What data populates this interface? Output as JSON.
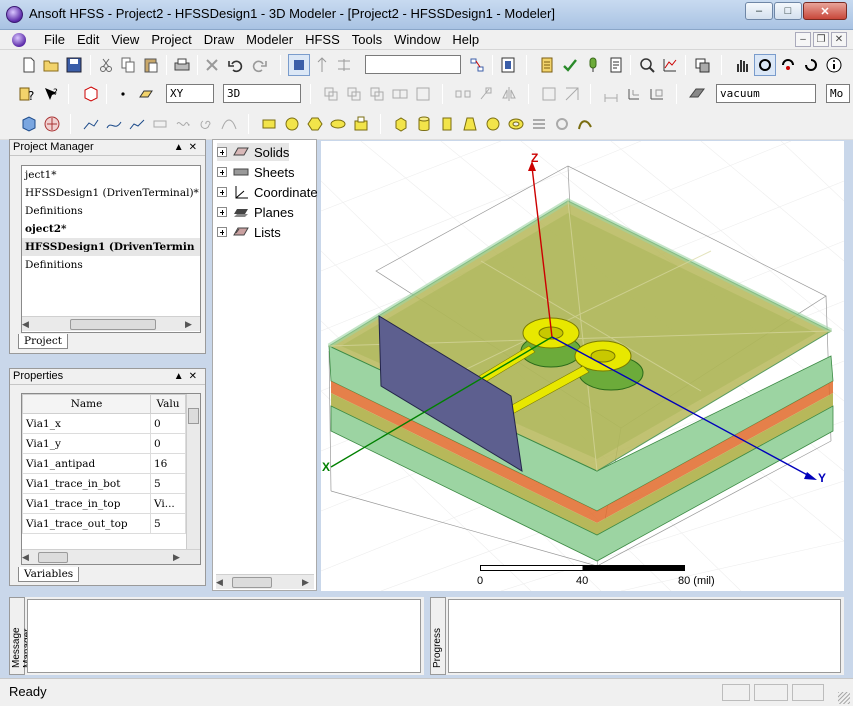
{
  "window": {
    "title": "Ansoft HFSS  - Project2 - HFSSDesign1 - 3D Modeler - [Project2 - HFSSDesign1 - Modeler]",
    "minimize": "–",
    "maximize": "□",
    "close": "✕"
  },
  "menu": [
    "File",
    "Edit",
    "View",
    "Project",
    "Draw",
    "Modeler",
    "HFSS",
    "Tools",
    "Window",
    "Help"
  ],
  "toolbar": {
    "plane_combo": "XY",
    "view_combo": "3D",
    "material_combo": "vacuum",
    "model_combo": "Mo",
    "empty_combo": ""
  },
  "project_manager": {
    "title": "Project Manager",
    "lines": [
      {
        "text": "ject1*",
        "style": ""
      },
      {
        "text": "HFSSDesign1 (DrivenTerminal)*",
        "style": ""
      },
      {
        "text": "Definitions",
        "style": ""
      },
      {
        "text": "oject2*",
        "style": "bold"
      },
      {
        "text": "HFSSDesign1 (DrivenTermin",
        "style": "bold sel"
      },
      {
        "text": "Definitions",
        "style": ""
      }
    ],
    "tab": "Project"
  },
  "properties": {
    "title": "Properties",
    "columns": [
      "Name",
      "Valu"
    ],
    "rows": [
      {
        "name": "Via1_x",
        "value": "0"
      },
      {
        "name": "Via1_y",
        "value": "0"
      },
      {
        "name": "Via1_antipad",
        "value": "16"
      },
      {
        "name": "Via1_trace_in_bot",
        "value": "5"
      },
      {
        "name": "Via1_trace_in_top",
        "value": "Vi..."
      },
      {
        "name": "Via1_trace_out_top",
        "value": "5"
      }
    ],
    "tab": "Variables"
  },
  "model_tree": [
    {
      "label": "Solids",
      "icon": "solids-icon"
    },
    {
      "label": "Sheets",
      "icon": "sheets-icon"
    },
    {
      "label": "Coordinate",
      "icon": "coordinate-icon"
    },
    {
      "label": "Planes",
      "icon": "planes-icon"
    },
    {
      "label": "Lists",
      "icon": "lists-icon"
    }
  ],
  "viewport": {
    "axis_z": "Z",
    "axis_x": "X",
    "axis_y": "Y",
    "scale_labels": [
      "0",
      "40",
      "80 (mil)"
    ]
  },
  "bottom": {
    "message_tab": "Message Manager",
    "progress_tab": "Progress"
  },
  "status": "Ready",
  "colors": {
    "substrate": "#b7b85a",
    "copper": "#d6a06a",
    "via": "#e8e800",
    "port": "#5d5f8f",
    "axis_z": "#cc0000",
    "axis_x": "#008000",
    "axis_y": "#0000bb"
  }
}
